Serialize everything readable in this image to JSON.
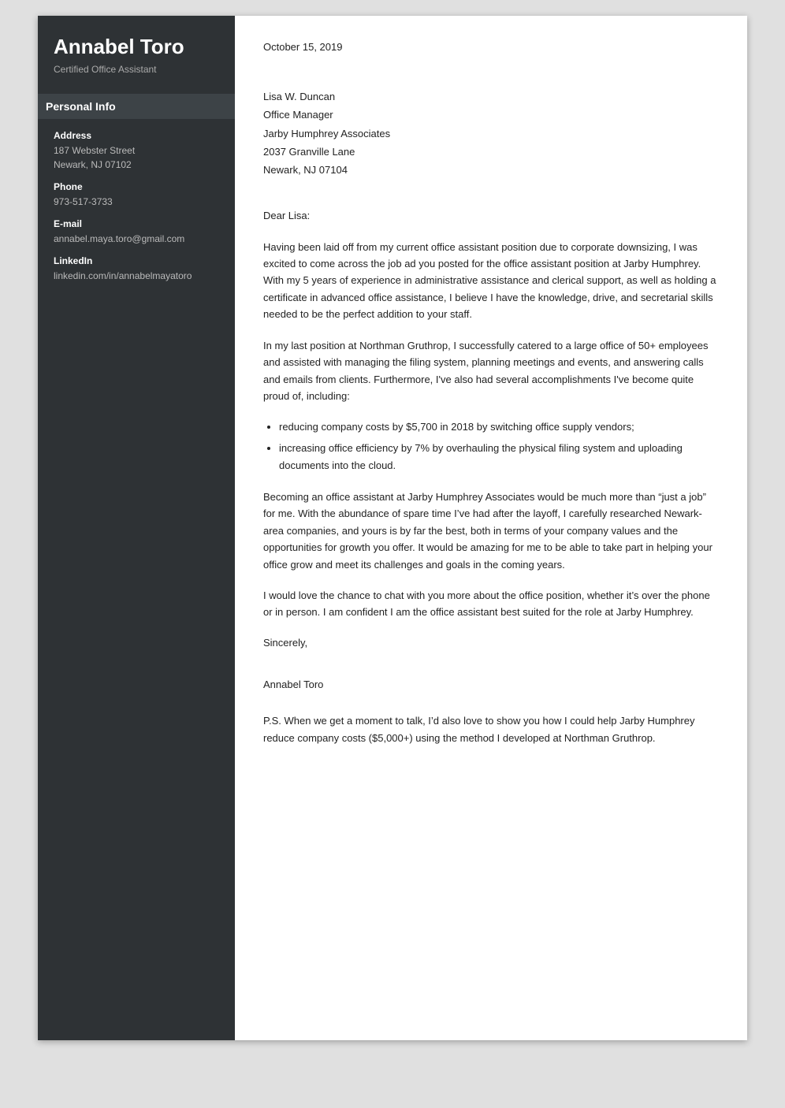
{
  "sidebar": {
    "name": "Annabel Toro",
    "title": "Certified Office Assistant",
    "personal_info_heading": "Personal Info",
    "address_label": "Address",
    "address_line1": "187 Webster Street",
    "address_line2": "Newark, NJ 07102",
    "phone_label": "Phone",
    "phone_value": "973-517-3733",
    "email_label": "E-mail",
    "email_value": "annabel.maya.toro@gmail.com",
    "linkedin_label": "LinkedIn",
    "linkedin_value": "linkedin.com/in/annabelmayatoro"
  },
  "letter": {
    "date": "October 15, 2019",
    "recipient_name": "Lisa W. Duncan",
    "recipient_title": "Office Manager",
    "recipient_company": "Jarby Humphrey Associates",
    "recipient_address1": "2037 Granville Lane",
    "recipient_address2": "Newark, NJ 07104",
    "salutation": "Dear Lisa:",
    "paragraph1": "Having been laid off from my current office assistant position due to corporate downsizing, I was excited to come across the job ad you posted for the office assistant position at Jarby Humphrey. With my 5 years of experience in administrative assistance and clerical support, as well as holding a certificate in advanced office assistance, I believe I have the knowledge, drive, and secretarial skills needed to be the perfect addition to your staff.",
    "paragraph2": "In my last position at Northman Gruthrop, I successfully catered to a large office of 50+ employees and assisted with managing the filing system, planning meetings and events, and answering calls and emails from clients. Furthermore, I've also had several accomplishments I've become quite proud of, including:",
    "bullet1": "reducing company costs by $5,700 in 2018 by switching office supply vendors;",
    "bullet2": "increasing office efficiency by 7% by overhauling the physical filing system and uploading documents into the cloud.",
    "paragraph3": "Becoming an office assistant at Jarby Humphrey Associates would be much more than “just a job” for me. With the abundance of spare time I’ve had after the layoff, I carefully researched Newark-area companies, and yours is by far the best, both in terms of your company values and the opportunities for growth you offer. It would be amazing for me to be able to take part in helping your office grow and meet its challenges and goals in the coming years.",
    "paragraph4": "I would love the chance to chat with you more about the office position, whether it’s over the phone or in person. I am confident I am the office assistant best suited for the role at Jarby Humphrey.",
    "closing": "Sincerely,",
    "signature_name": "Annabel Toro",
    "ps": "P.S. When we get a moment to talk, I’d also love to show you how I could help Jarby Humphrey reduce company costs ($5,000+) using the method I developed at Northman Gruthrop."
  }
}
